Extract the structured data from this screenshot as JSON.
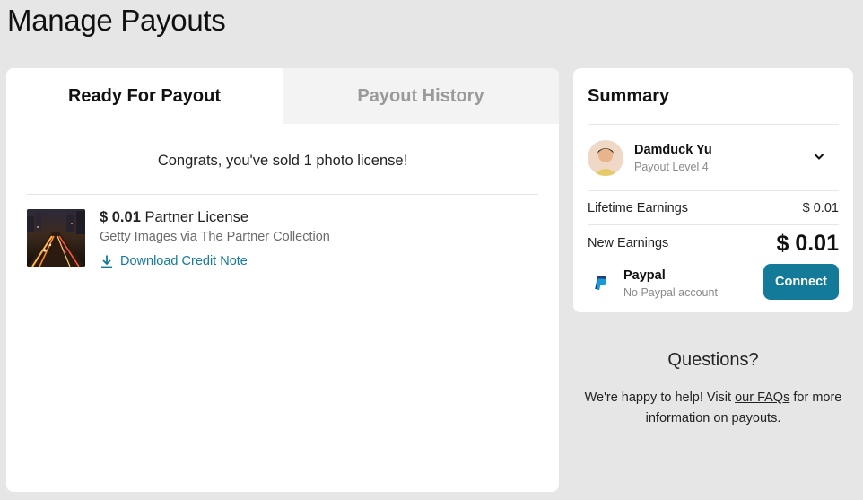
{
  "page": {
    "title": "Manage Payouts"
  },
  "tabs": [
    {
      "label": "Ready For Payout",
      "active": true
    },
    {
      "label": "Payout History",
      "active": false
    }
  ],
  "main": {
    "congrats": "Congrats, you've sold 1 photo license!",
    "license": {
      "amount": "$ 0.01",
      "type": "Partner License",
      "source": "Getty Images via The Partner Collection",
      "download_label": "Download Credit Note"
    }
  },
  "summary": {
    "title": "Summary",
    "user": {
      "name": "Damduck Yu",
      "level": "Payout Level 4"
    },
    "lifetime": {
      "label": "Lifetime Earnings",
      "value": "$ 0.01"
    },
    "new_earnings": {
      "label": "New Earnings",
      "value": "$ 0.01"
    },
    "paypal": {
      "name": "Paypal",
      "status": "No Paypal account",
      "button": "Connect"
    }
  },
  "questions": {
    "title": "Questions?",
    "text_before": "We're happy to help! Visit ",
    "link": "our FAQs",
    "text_after": " for more information on payouts."
  },
  "colors": {
    "accent": "#137a9a",
    "background": "#e6e6e6",
    "card": "#ffffff",
    "tab_inactive": "#f3f3f3"
  }
}
